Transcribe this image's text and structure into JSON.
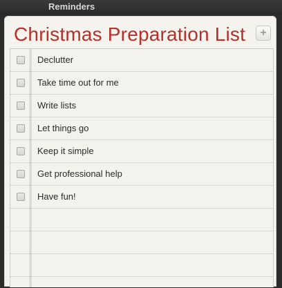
{
  "window": {
    "app_title": "Reminders"
  },
  "list": {
    "title": "Christmas Preparation List",
    "add_label": "+",
    "items": [
      {
        "text": "Declutter",
        "checked": false
      },
      {
        "text": "Take time out for me",
        "checked": false
      },
      {
        "text": "Write lists",
        "checked": false
      },
      {
        "text": "Let things go",
        "checked": false
      },
      {
        "text": "Keep it simple",
        "checked": false
      },
      {
        "text": "Get professional help",
        "checked": false
      },
      {
        "text": "Have fun!",
        "checked": false
      }
    ]
  },
  "colors": {
    "title": "#b3312b",
    "paper": "#f4f3ee",
    "margin_line": "#e8a9ac",
    "window_chrome": "#2b2b2b"
  }
}
